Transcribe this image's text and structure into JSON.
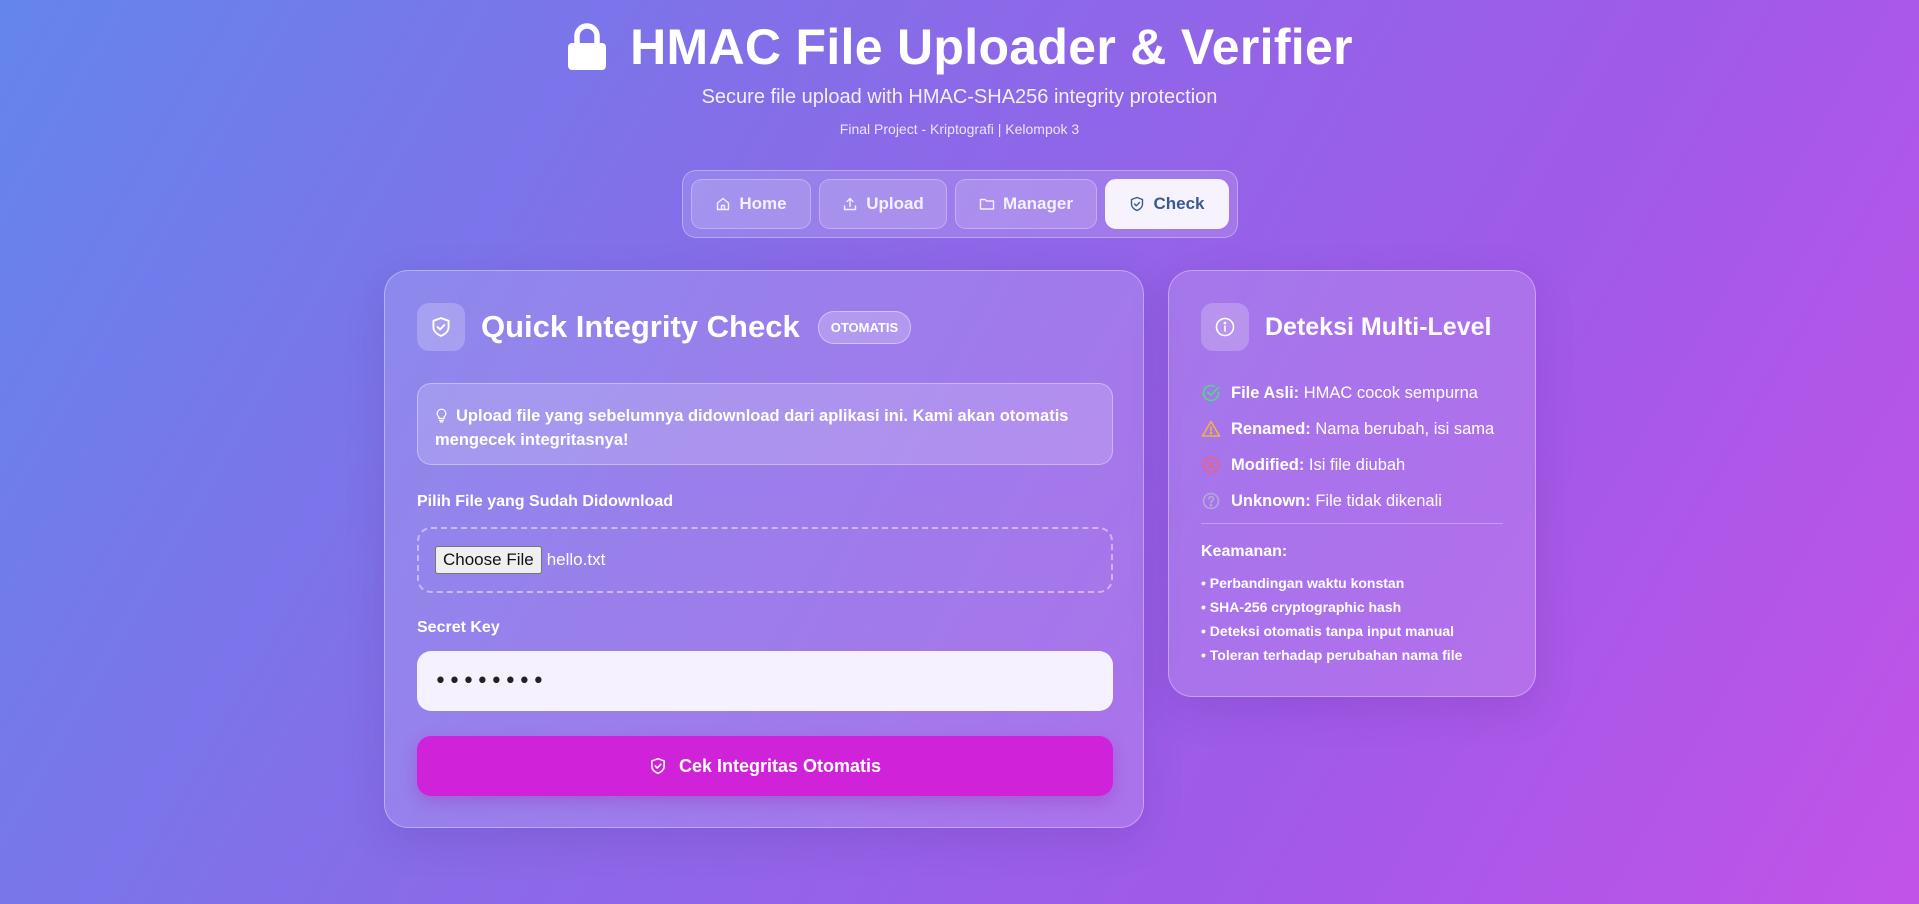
{
  "header": {
    "title": "HMAC File Uploader & Verifier",
    "subtitle": "Secure file upload with HMAC-SHA256 integrity protection",
    "project": "Final Project - Kriptografi | Kelompok 3",
    "icon": "lock-icon"
  },
  "nav": {
    "tabs": [
      {
        "label": "Home",
        "icon": "home-icon"
      },
      {
        "label": "Upload",
        "icon": "upload-icon"
      },
      {
        "label": "Manager",
        "icon": "folder-icon"
      },
      {
        "label": "Check",
        "icon": "shield-check-icon"
      }
    ],
    "active": "Check"
  },
  "main": {
    "title": "Quick Integrity Check",
    "badge": "OTOMATIS",
    "tip": "Upload file yang sebelumnya didownload dari aplikasi ini. Kami akan otomatis mengecek integritasnya!",
    "file_label": "Pilih File yang Sudah Didownload",
    "choose_button": "Choose File",
    "file_name": "hello.txt",
    "key_label": "Secret Key",
    "key_value": "••••••••",
    "submit": "Cek Integritas Otomatis"
  },
  "side": {
    "title": "Deteksi Multi-Level",
    "levels": [
      {
        "name": "File Asli:",
        "desc": "HMAC cocok sempurna",
        "color": "#4ade80",
        "icon": "check-circle-icon"
      },
      {
        "name": "Renamed:",
        "desc": "Nama berubah, isi sama",
        "color": "#f5b43a",
        "icon": "warning-icon"
      },
      {
        "name": "Modified:",
        "desc": "Isi file diubah",
        "color": "#f0607a",
        "icon": "x-circle-icon"
      },
      {
        "name": "Unknown:",
        "desc": "File tidak dikenali",
        "color": "#b6a8d8",
        "icon": "question-circle-icon"
      }
    ],
    "security_title": "Keamanan:",
    "security_items": [
      "• Perbandingan waktu konstan",
      "• SHA-256 cryptographic hash",
      "• Deteksi otomatis tanpa input manual",
      "• Toleran terhadap perubahan nama file"
    ]
  },
  "colors": {
    "accent_button": "#d022d8",
    "active_tab_text": "#3a5b8c"
  }
}
